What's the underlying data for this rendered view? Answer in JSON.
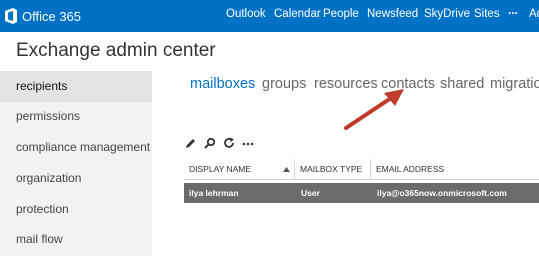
{
  "topbar": {
    "brand": "Office 365",
    "nav": [
      "Outlook",
      "Calendar",
      "People",
      "Newsfeed",
      "SkyDrive",
      "Sites",
      "...",
      "Ad"
    ]
  },
  "page": {
    "title": "Exchange admin center"
  },
  "sidebar": {
    "items": [
      {
        "label": "recipients",
        "selected": true
      },
      {
        "label": "permissions"
      },
      {
        "label": "compliance management"
      },
      {
        "label": "organization"
      },
      {
        "label": "protection"
      },
      {
        "label": "mail flow"
      }
    ]
  },
  "tabs": [
    {
      "label": "mailboxes",
      "active": true
    },
    {
      "label": "groups"
    },
    {
      "label": "resources"
    },
    {
      "label": "contacts"
    },
    {
      "label": "shared"
    },
    {
      "label": "migratio"
    }
  ],
  "toolbar": {
    "icons": [
      "pencil-icon",
      "search-icon",
      "refresh-icon",
      "more-icon"
    ]
  },
  "table": {
    "columns": [
      "DISPLAY NAME",
      "MAILBOX TYPE",
      "EMAIL ADDRESS"
    ],
    "rows": [
      {
        "name": "ilya lehrman",
        "type": "User",
        "email": "ilya@o365now.onmicrosoft.com",
        "selected": true
      }
    ]
  },
  "colors": {
    "accent": "#0072c6",
    "arrow": "#c0392b",
    "selected_row": "#6b6b6b"
  }
}
